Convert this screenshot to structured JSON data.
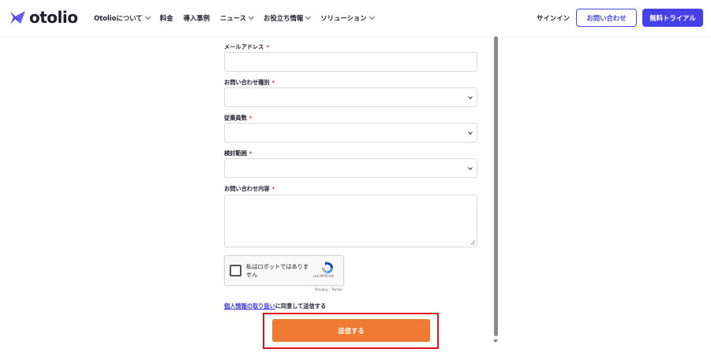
{
  "header": {
    "logo_text": "otolio",
    "nav": [
      {
        "label": "Otolioについて",
        "has_dropdown": true
      },
      {
        "label": "料金",
        "has_dropdown": false
      },
      {
        "label": "導入事例",
        "has_dropdown": false
      },
      {
        "label": "ニュース",
        "has_dropdown": true
      },
      {
        "label": "お役立ち情報",
        "has_dropdown": true
      },
      {
        "label": "ソリューション",
        "has_dropdown": true
      }
    ],
    "signin_label": "サインイン",
    "contact_label": "お問い合わせ",
    "trial_label": "無料トライアル"
  },
  "form": {
    "email_label": "メールアドレス",
    "inquiry_type_label": "お問い合わせ種別",
    "employees_label": "従業員数",
    "scope_label": "検討範囲",
    "message_label": "お問い合わせ内容",
    "required_mark": "*",
    "email_value": "",
    "inquiry_type_value": "",
    "employees_value": "",
    "scope_value": "",
    "message_value": ""
  },
  "recaptcha": {
    "checkbox_label": "私はロボットではありません",
    "brand": "reCAPTCHA",
    "links": "Privacy - Terms"
  },
  "consent": {
    "link_text": "個人情報の取り扱い",
    "suffix": "に同意して送信する"
  },
  "submit_label": "送信する",
  "colors": {
    "brand": "#4740e6",
    "submit": "#ef7a33",
    "highlight": "#e3101e",
    "required": "#e0353b"
  }
}
